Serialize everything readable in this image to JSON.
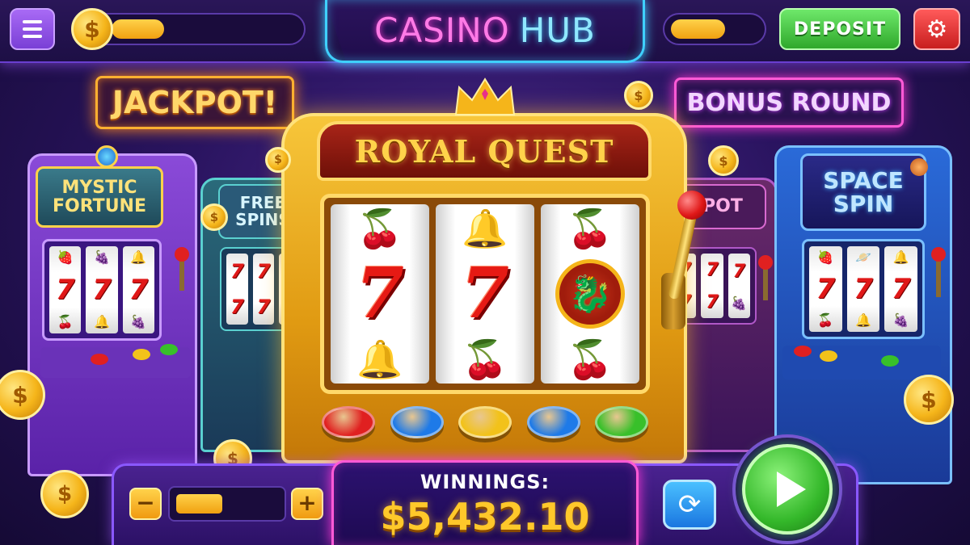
{
  "header": {
    "title_part1": "CASINO",
    "title_part2": "HUB",
    "coin_symbol": "$",
    "deposit_label": "DEPOSIT",
    "balance_fill_fraction": 0.28,
    "secondary_fill_fraction": 0.6
  },
  "signs": {
    "jackpot": "JACKPOT!",
    "bonus": "BONUS ROUND"
  },
  "machines": {
    "left1": {
      "title_line1": "MYSTIC",
      "title_line2": "FORTUNE"
    },
    "left2": {
      "title_line1": "FREE",
      "title_line2": "SPINS"
    },
    "right1": {
      "title": "SPOT"
    },
    "right2": {
      "title_line1": "SPACE",
      "title_line2": "SPIN"
    }
  },
  "main_machine": {
    "title": "ROYAL QUEST",
    "reels": [
      {
        "top": "🍒",
        "middle": "7",
        "bottom": "🔔"
      },
      {
        "top": "🔔",
        "middle": "7",
        "bottom": "🍒"
      },
      {
        "top": "🍒",
        "middle": "dragon",
        "bottom": "🍒"
      }
    ],
    "middle_symbol_7": "7",
    "dragon_symbol": "🐉",
    "bet_button_colors": [
      "#e02020",
      "#1e7ae8",
      "#f2c21a",
      "#1e7ae8",
      "#38c02a"
    ]
  },
  "bottom": {
    "minus": "−",
    "plus": "+",
    "bet_fill_fraction": 0.45,
    "winnings_label": "WINNINGS:",
    "winnings_value": "$5,432.10",
    "refresh_icon": "⟳"
  },
  "icons": {
    "menu": "menu-icon",
    "settings": "gear-icon",
    "refresh": "refresh-icon",
    "spin": "play-icon"
  }
}
